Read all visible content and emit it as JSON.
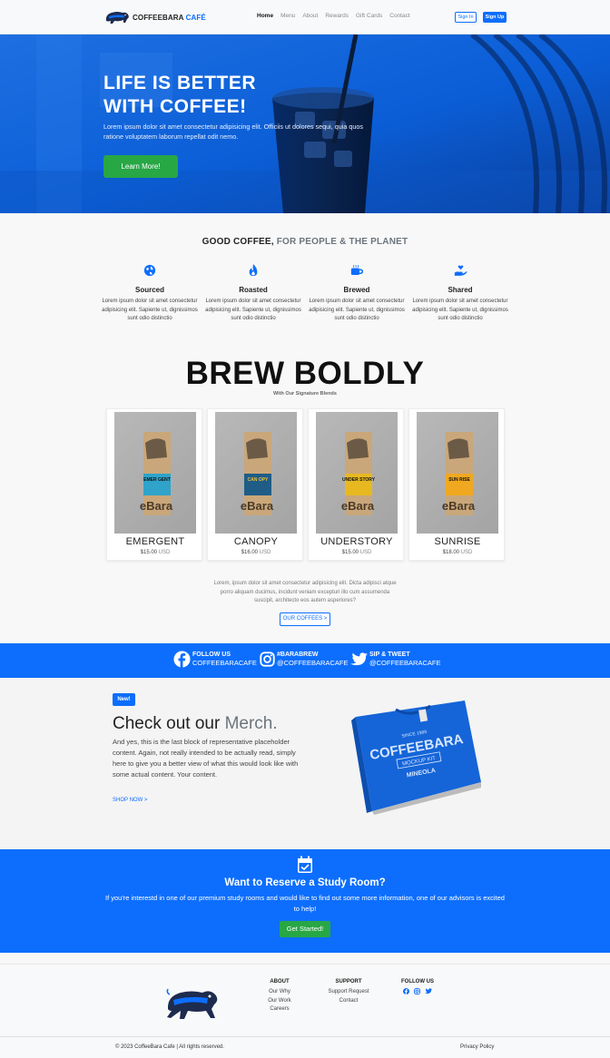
{
  "nav": {
    "brand_main": "COFFEEBARA",
    "brand_cafe": "CAFÉ",
    "links": [
      "Home",
      "Menu",
      "About",
      "Rewards",
      "Gift Cards",
      "Contact"
    ],
    "sign_in": "Sign In",
    "sign_up": "Sign Up"
  },
  "hero": {
    "title_line1": "LIFE IS BETTER",
    "title_line2": "WITH COFFEE!",
    "subtitle": "Lorem ipsum dolor sit amet consectetur adipisicing elit. Officiis ut dolores sequi, quia quos ratione voluptatem laborum repellat odit nemo.",
    "button": "Learn More!"
  },
  "good_coffee": {
    "title_bold": "GOOD COFFEE,",
    "title_muted": "FOR PEOPLE & THE PLANET",
    "features": [
      {
        "icon": "globe-icon",
        "name": "Sourced",
        "desc": "Lorem ipsum dolor sit amet consectetur adipisicing elit. Sapiente ut, dignissimos sunt odio distinctio"
      },
      {
        "icon": "fire-icon",
        "name": "Roasted",
        "desc": "Lorem ipsum dolor sit amet consectetur adipisicing elit. Sapiente ut, dignissimos sunt odio distinctio"
      },
      {
        "icon": "cup-icon",
        "name": "Brewed",
        "desc": "Lorem ipsum dolor sit amet consectetur adipisicing elit. Sapiente ut, dignissimos sunt odio distinctio"
      },
      {
        "icon": "hand-heart-icon",
        "name": "Shared",
        "desc": "Lorem ipsum dolor sit amet consectetur adipisicing elit. Sapiente ut, dignissimos sunt odio distinctio"
      }
    ]
  },
  "brew": {
    "title": "BREW BOLDLY",
    "subtitle": "With Our Signature Blends",
    "products": [
      {
        "name": "EMERGENT",
        "price": "$15.00",
        "currency": "USD",
        "label": "EMER GENT",
        "color": "#2fa3c9"
      },
      {
        "name": "CANOPY",
        "price": "$16.00",
        "currency": "USD",
        "label": "CAN OPY",
        "color": "#1f5d87"
      },
      {
        "name": "UNDERSTORY",
        "price": "$15.00",
        "currency": "USD",
        "label": "UNDER STORY",
        "color": "#e7b820"
      },
      {
        "name": "SUNRISE",
        "price": "$18.00",
        "currency": "USD",
        "label": "SUN RISE",
        "color": "#f0a820"
      }
    ],
    "bag_text": "eBara",
    "description": "Lorem, ipsum dolor sit amet consectetur adipisicing elit. Dicta adipisci atque porro aliquam ducimus, incidunt veniam excepturi illo cum assumenda suscipit, architecto eos autem asperiores?",
    "button": "OUR COFFEES >"
  },
  "social": [
    {
      "icon": "facebook-icon",
      "line1": "FOLLOW US",
      "line2": "COFFEEBARACAFE"
    },
    {
      "icon": "instagram-icon",
      "line1": "#BARABREW",
      "line2": "@COFFEEBARACAFE"
    },
    {
      "icon": "twitter-icon",
      "line1": "SIP & TWEET",
      "line2": "@COFFEEBARACAFE"
    }
  ],
  "merch": {
    "badge": "New!",
    "title_main": "Check out our",
    "title_muted": "Merch.",
    "text": "And yes, this is the last block of representative placeholder content. Again, not really intended to be actually read, simply here to give you a better view of what this would look like with some actual content. Your content.",
    "link": "SHOP NOW >",
    "shirt_brand": "COFFEEBARA",
    "shirt_since": "SINCE 1989",
    "shirt_mockup": "MOCKUP KIT",
    "shirt_city": "MINEOLA"
  },
  "reserve": {
    "title": "Want to Reserve a Study Room?",
    "text": "If you're interestd in one of our premium study rooms and would like to find out some more information, one of our advisors is excited to help!",
    "button": "Get Started!"
  },
  "footer": {
    "about": {
      "heading": "ABOUT",
      "links": [
        "Our Why",
        "Our Work",
        "Careers"
      ]
    },
    "support": {
      "heading": "SUPPORT",
      "links": [
        "Support Request",
        "Contact"
      ]
    },
    "follow": {
      "heading": "FOLLOW US"
    },
    "copyright": "© 2023 CoffeeBara Cafe | All rights reserved.",
    "privacy": "Privacy Policy"
  },
  "colors": {
    "primary": "#0d6efd",
    "success": "#28a745"
  }
}
